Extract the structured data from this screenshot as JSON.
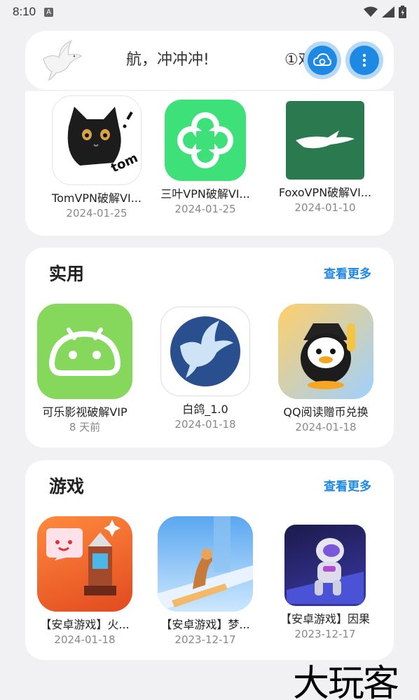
{
  "status_bar": {
    "time": "8:10",
    "badge": "A"
  },
  "header": {
    "marquee_part1": "航，冲冲冲!",
    "marquee_part2": "①欢迎",
    "cloud_icon": "cloud-refresh-icon",
    "more_icon": "more-vertical-icon"
  },
  "sections": {
    "vpn": {
      "apps": [
        {
          "name": "TomVPN破解VI...",
          "date": "2024-01-25",
          "icon": "black-cat-tom-icon"
        },
        {
          "name": "三叶VPN破解VI...",
          "date": "2024-01-25",
          "icon": "green-clover-icon"
        },
        {
          "name": "FoxoVPN破解VI...",
          "date": "2024-01-10",
          "icon": "white-fox-icon"
        }
      ]
    },
    "practical": {
      "title": "实用",
      "more": "查看更多",
      "apps": [
        {
          "name": "可乐影视破解VIP",
          "date": "8 天前",
          "icon": "android-icon"
        },
        {
          "name": "白鸽_1.0",
          "date": "2024-01-18",
          "icon": "white-dove-icon"
        },
        {
          "name": "QQ阅读赠币兑换",
          "date": "2024-01-18",
          "icon": "qq-penguin-icon"
        }
      ]
    },
    "games": {
      "title": "游戏",
      "more": "查看更多",
      "apps": [
        {
          "name": "【安卓游戏】火...",
          "date": "2024-01-18",
          "icon": "pixel-rocket-game-icon"
        },
        {
          "name": "【安卓游戏】梦...",
          "date": "2023-12-17",
          "icon": "monument-path-game-icon"
        },
        {
          "name": "【安卓游戏】因果",
          "date": "2023-12-17",
          "icon": "astronaut-game-icon"
        }
      ]
    }
  },
  "watermark": "大玩客",
  "colors": {
    "accent": "#1e88e5",
    "background": "#f1f1f3",
    "card": "#ffffff"
  }
}
